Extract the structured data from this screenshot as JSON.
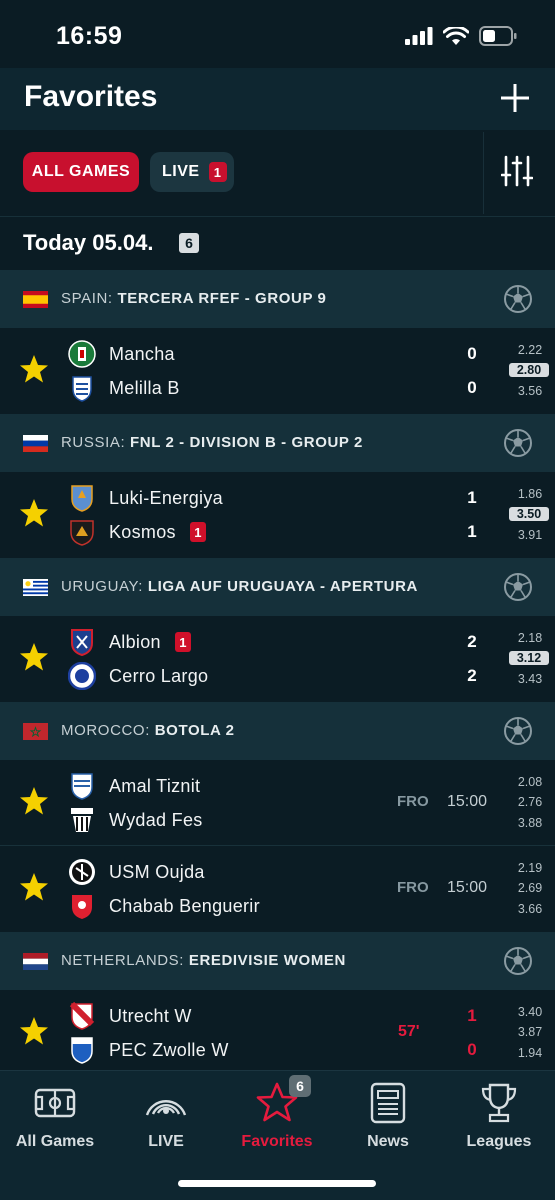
{
  "status_bar": {
    "time": "16:59"
  },
  "header": {
    "title": "Favorites"
  },
  "filters": {
    "all_games": "ALL GAMES",
    "live": "LIVE",
    "live_count": "1"
  },
  "date": {
    "label": "Today 05.04.",
    "count": "6"
  },
  "leagues": [
    {
      "country": "SPAIN:",
      "name": "TERCERA RFEF - GROUP 9",
      "matches": [
        {
          "home": "Mancha",
          "away": "Melilla B",
          "home_score": "0",
          "away_score": "0",
          "home_red": "",
          "away_red": "",
          "odds": [
            "2.22",
            "2.80",
            "3.56"
          ]
        }
      ]
    },
    {
      "country": "RUSSIA:",
      "name": "FNL 2 - DIVISION B - GROUP 2",
      "matches": [
        {
          "home": "Luki-Energiya",
          "away": "Kosmos",
          "home_score": "1",
          "away_score": "1",
          "home_red": "",
          "away_red": "1",
          "odds": [
            "1.86",
            "3.50",
            "3.91"
          ]
        }
      ]
    },
    {
      "country": "URUGUAY:",
      "name": "LIGA AUF URUGUAYA - APERTURA",
      "matches": [
        {
          "home": "Albion",
          "away": "Cerro Largo",
          "home_score": "2",
          "away_score": "2",
          "home_red": "1",
          "away_red": "",
          "odds": [
            "2.18",
            "3.12",
            "3.43"
          ]
        }
      ]
    },
    {
      "country": "MOROCCO:",
      "name": "BOTOLA 2",
      "matches": [
        {
          "home": "Amal Tiznit",
          "away": "Wydad Fes",
          "status": "FRO",
          "time": "15:00",
          "odds": [
            "2.08",
            "2.76",
            "3.88"
          ]
        },
        {
          "home": "USM Oujda",
          "away": "Chabab Benguerir",
          "status": "FRO",
          "time": "15:00",
          "odds": [
            "2.19",
            "2.69",
            "3.66"
          ]
        }
      ]
    },
    {
      "country": "NETHERLANDS:",
      "name": "EREDIVISIE WOMEN",
      "matches": [
        {
          "home": "Utrecht W",
          "away": "PEC Zwolle W",
          "minute": "57'",
          "home_score": "1",
          "away_score": "0",
          "odds": [
            "3.40",
            "3.87",
            "1.94"
          ]
        }
      ]
    }
  ],
  "tabs": [
    {
      "label": "All Games",
      "icon": "pitch-icon"
    },
    {
      "label": "LIVE",
      "icon": "live-icon"
    },
    {
      "label": "Favorites",
      "icon": "star-icon",
      "badge": "6"
    },
    {
      "label": "News",
      "icon": "news-icon"
    },
    {
      "label": "Leagues",
      "icon": "trophy-icon"
    }
  ],
  "colors": {
    "accent": "#c8102e",
    "live_red": "#e51b3e",
    "star": "#f5d000",
    "background": "#0b1c24",
    "league_bg": "#15303a"
  }
}
